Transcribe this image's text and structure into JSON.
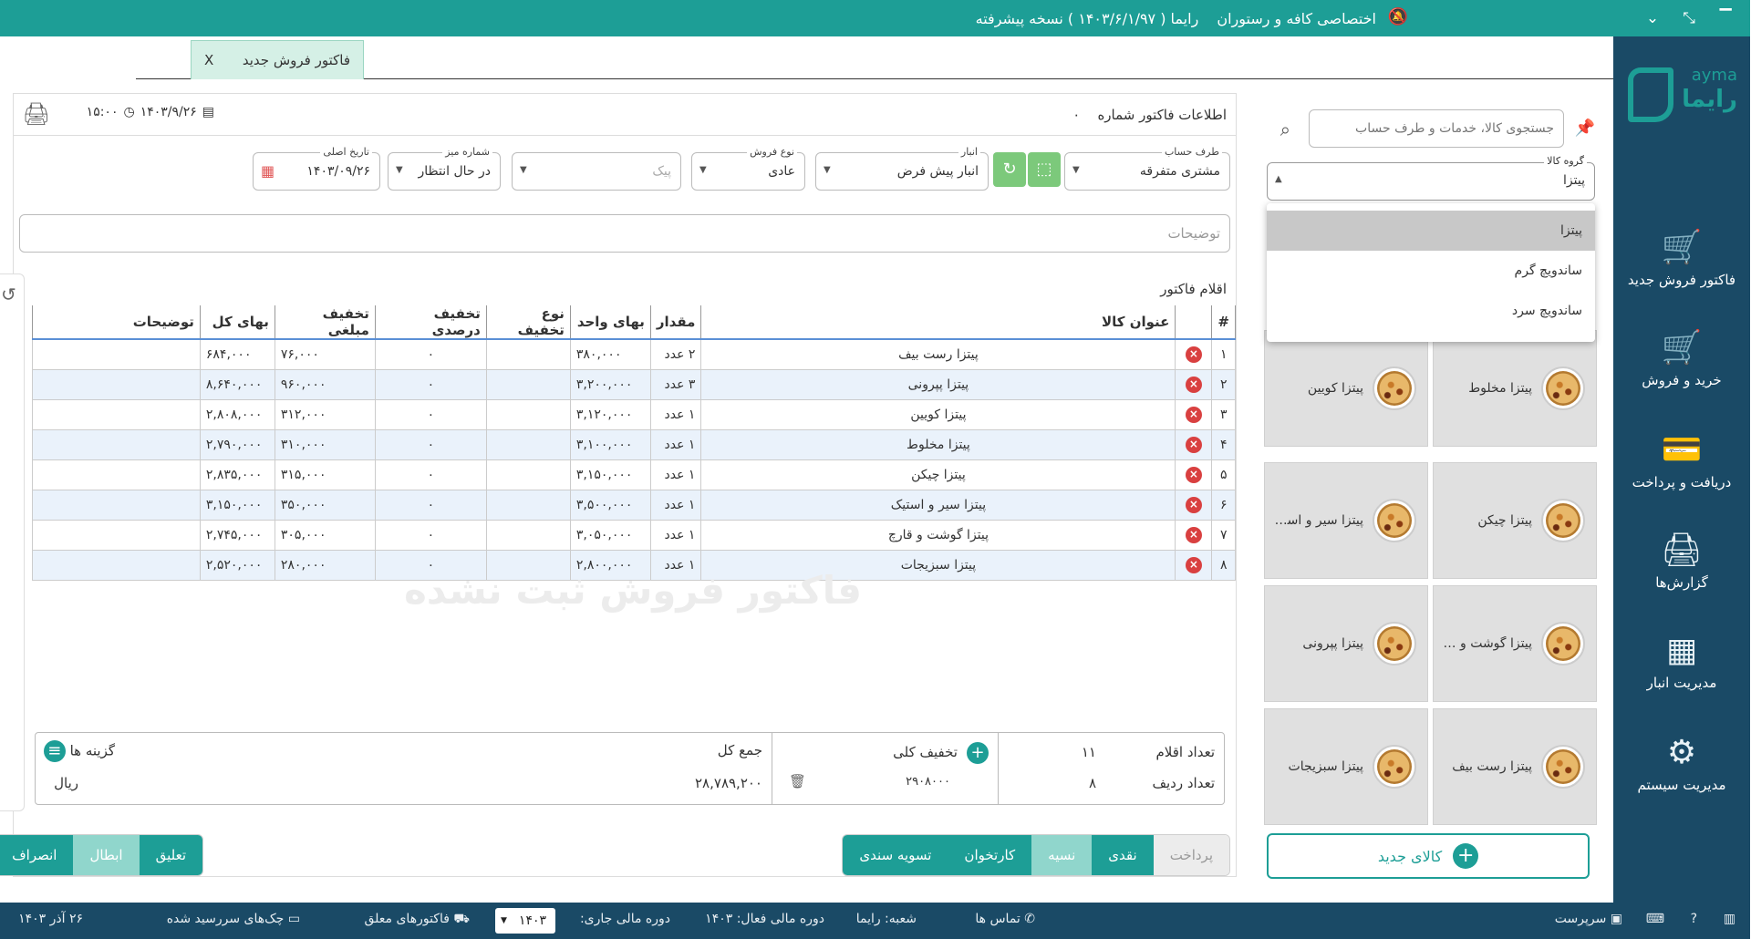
{
  "titlebar": {
    "app_title": "رایما ( ۱۴۰۳/۶/۱/۹۷ ) نسخه پیشرفته",
    "edition": "اختصاصی کافه و رستوران"
  },
  "sidebar": {
    "brand_en": "ayma",
    "brand_fa": "رایما",
    "items": [
      {
        "label": "فاکتور فروش جدید",
        "icon": "cart-add-icon"
      },
      {
        "label": "خرید و فروش",
        "icon": "cart-icon"
      },
      {
        "label": "دریافت و پرداخت",
        "icon": "credit-card-icon"
      },
      {
        "label": "گزارش‌ها",
        "icon": "printer-icon"
      },
      {
        "label": "مدیریت انبار",
        "icon": "grid-icon"
      },
      {
        "label": "مدیریت سیستم",
        "icon": "gear-icon"
      }
    ]
  },
  "tab": {
    "label": "فاکتور فروش جدید",
    "close": "X"
  },
  "goods": {
    "search_placeholder": "جستجوی کالا، خدمات و طرف حساب",
    "group_label": "گروه کالا",
    "group_value": "پیتزا",
    "group_options": [
      "پیتزا",
      "ساندویچ گرم",
      "ساندویچ سرد"
    ],
    "tiles": [
      "پیتزا مخلوط",
      "پیتزا کویین",
      "پیتزا چیکن",
      "پیتزا سیر و استی...",
      "پیتزا گوشت و قا...",
      "پیتزا پپرونی",
      "پیتزا رست بیف",
      "پیتزا سبزیجات"
    ],
    "new_good": "کالای جدید"
  },
  "invoice": {
    "title": "اطلاعات فاکتور شماره",
    "number": "۰",
    "date": "۱۴۰۳/۹/۲۶",
    "time": "۱۵:۰۰",
    "fields": {
      "account_label": "طرف حساب",
      "account": "مشتری متفرقه",
      "warehouse_label": "انبار",
      "warehouse": "انبار پیش فرض",
      "sale_type_label": "نوع فروش",
      "sale_type": "عادی",
      "courier_placeholder": "پیک",
      "table_label": "شماره میز",
      "table": "در حال انتظار",
      "orig_date_label": "تاریخ اصلی",
      "orig_date": "۱۴۰۳/۰۹/۲۶"
    },
    "description_placeholder": "توضیحات",
    "items_title": "اقلام فاکتور",
    "watermark": "فاکتور فروش ثبت نشده",
    "columns": [
      "#",
      "",
      "عنوان کالا",
      "مقدار",
      "بهای واحد",
      "نوع تخفیف",
      "تخفیف درصدی",
      "تخفیف مبلغی",
      "بهای کل",
      "توضیحات"
    ],
    "rows": [
      {
        "n": "۱",
        "name": "پیتزا رست بیف",
        "qty": "۲ عدد",
        "unit": "۳۸۰,۰۰۰",
        "dtype": "",
        "dpct": "۰",
        "damt": "۷۶,۰۰۰",
        "total": "۶۸۴,۰۰۰",
        "note": ""
      },
      {
        "n": "۲",
        "name": "پیتزا پپرونی",
        "qty": "۳ عدد",
        "unit": "۳,۲۰۰,۰۰۰",
        "dtype": "",
        "dpct": "۰",
        "damt": "۹۶۰,۰۰۰",
        "total": "۸,۶۴۰,۰۰۰",
        "note": ""
      },
      {
        "n": "۳",
        "name": "پیتزا کویین",
        "qty": "۱ عدد",
        "unit": "۳,۱۲۰,۰۰۰",
        "dtype": "",
        "dpct": "۰",
        "damt": "۳۱۲,۰۰۰",
        "total": "۲,۸۰۸,۰۰۰",
        "note": ""
      },
      {
        "n": "۴",
        "name": "پیتزا مخلوط",
        "qty": "۱ عدد",
        "unit": "۳,۱۰۰,۰۰۰",
        "dtype": "",
        "dpct": "۰",
        "damt": "۳۱۰,۰۰۰",
        "total": "۲,۷۹۰,۰۰۰",
        "note": ""
      },
      {
        "n": "۵",
        "name": "پیتزا چیکن",
        "qty": "۱ عدد",
        "unit": "۳,۱۵۰,۰۰۰",
        "dtype": "",
        "dpct": "۰",
        "damt": "۳۱۵,۰۰۰",
        "total": "۲,۸۳۵,۰۰۰",
        "note": ""
      },
      {
        "n": "۶",
        "name": "پیتزا سیر و استیک",
        "qty": "۱ عدد",
        "unit": "۳,۵۰۰,۰۰۰",
        "dtype": "",
        "dpct": "۰",
        "damt": "۳۵۰,۰۰۰",
        "total": "۳,۱۵۰,۰۰۰",
        "note": ""
      },
      {
        "n": "۷",
        "name": "پیتزا گوشت و قارچ",
        "qty": "۱ عدد",
        "unit": "۳,۰۵۰,۰۰۰",
        "dtype": "",
        "dpct": "۰",
        "damt": "۳۰۵,۰۰۰",
        "total": "۲,۷۴۵,۰۰۰",
        "note": ""
      },
      {
        "n": "۸",
        "name": "پیتزا سبزیجات",
        "qty": "۱ عدد",
        "unit": "۲,۸۰۰,۰۰۰",
        "dtype": "",
        "dpct": "۰",
        "damt": "۲۸۰,۰۰۰",
        "total": "۲,۵۲۰,۰۰۰",
        "note": ""
      }
    ],
    "summary": {
      "items_count_label": "تعداد اقلام",
      "items_count": "۱۱",
      "rows_count_label": "تعداد ردیف",
      "rows_count": "۸",
      "discount_label": "تخفیف کلی",
      "discount": "۲۹۰۸۰۰۰",
      "total_label": "جمع کل",
      "total": "۲۸,۷۸۹,۲۰۰",
      "options_label": "گزینه ها",
      "currency": "ریال"
    },
    "payment": [
      "پرداخت",
      "نقدی",
      "نسیه",
      "کارتخوان",
      "تسویه سندی"
    ],
    "actions": [
      "تعلیق",
      "ابطال",
      "انصراف"
    ]
  },
  "status": {
    "user": "سرپرست",
    "contact": "تماس ها",
    "branch": "شعبه: رایما",
    "active_period": "دوره مالی فعال: ۱۴۰۳",
    "current_period": "دوره مالی جاری:",
    "year": "۱۴۰۳",
    "pending": "فاکتورهای معلق",
    "due_checks": "چک‌های سررسید شده",
    "date": "۲۶ آذر ۱۴۰۳"
  }
}
